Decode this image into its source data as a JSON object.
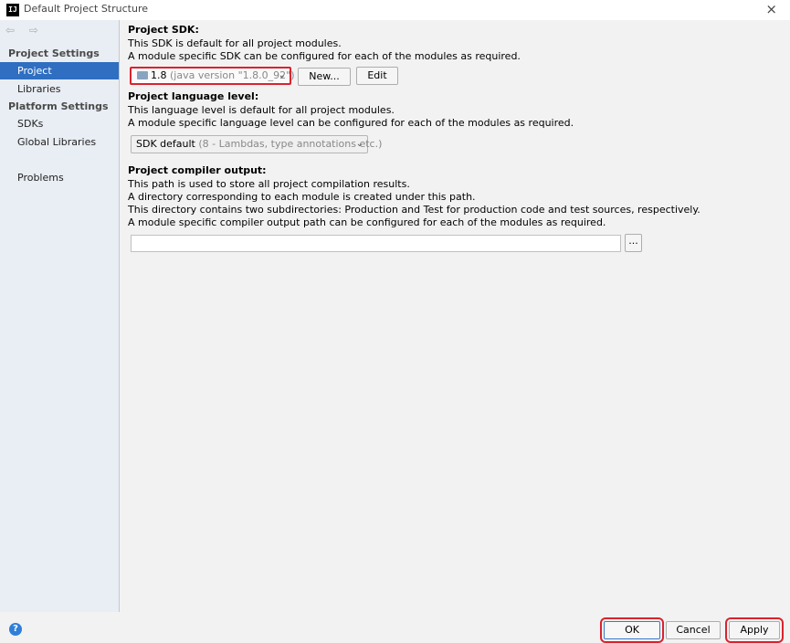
{
  "window": {
    "title": "Default Project Structure",
    "app_icon_text": "IJ",
    "close_glyph": "×"
  },
  "sidebar": {
    "nav_arrows": "⇦ ⇨",
    "project_settings_heading": "Project Settings",
    "platform_settings_heading": "Platform Settings",
    "items": [
      {
        "label": "Project",
        "selected": true
      },
      {
        "label": "Libraries"
      },
      {
        "label": "SDKs"
      },
      {
        "label": "Global Libraries"
      },
      {
        "label": "Problems"
      }
    ]
  },
  "project_sdk": {
    "heading": "Project SDK:",
    "lines": [
      "This SDK is default for all project modules.",
      "A module specific SDK can be configured for each of the modules as required."
    ],
    "selected_version": "1.8",
    "selected_detail": "(java version \"1.8.0_92\")",
    "new_button": "New...",
    "edit_button": "Edit"
  },
  "language_level": {
    "heading": "Project language level:",
    "lines": [
      "This language level is default for all project modules.",
      "A module specific language level can be configured for each of the modules as required."
    ],
    "selected_main": "SDK default",
    "selected_detail": "(8 - Lambdas, type annotations etc.)"
  },
  "compiler_output": {
    "heading": "Project compiler output:",
    "lines": [
      "This path is used to store all project compilation results.",
      "A directory corresponding to each module is created under this path.",
      "This directory contains two subdirectories: Production and Test for production code and test sources, respectively.",
      "A module specific compiler output path can be configured for each of the modules as required."
    ],
    "path_value": "",
    "browse_button": "..."
  },
  "footer": {
    "help_glyph": "?",
    "ok": "OK",
    "cancel": "Cancel",
    "apply": "Apply"
  },
  "colors": {
    "selection": "#2f6ec1",
    "highlight_red": "#d9232e"
  }
}
